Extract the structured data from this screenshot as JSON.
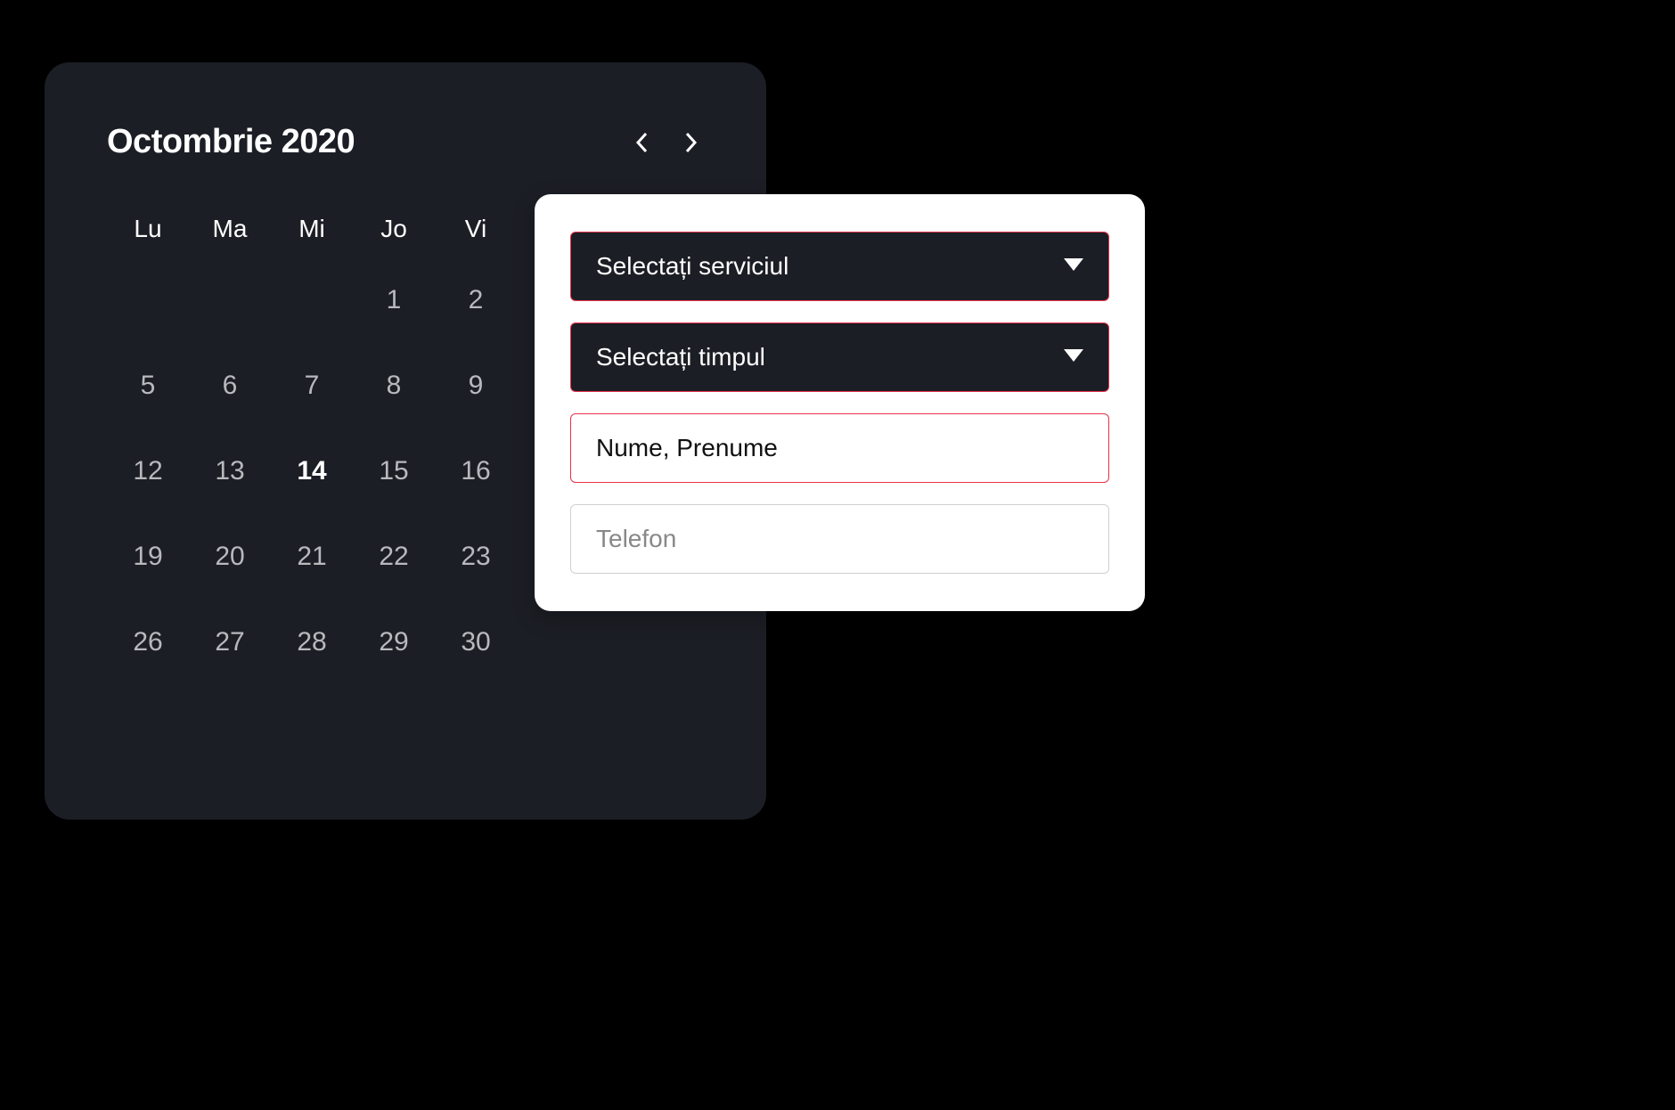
{
  "calendar": {
    "month_title": "Octombrie 2020",
    "weekdays": [
      "Lu",
      "Ma",
      "Mi",
      "Jo",
      "Vi"
    ],
    "days": [
      [
        "",
        "",
        "",
        "1",
        "2"
      ],
      [
        "5",
        "6",
        "7",
        "8",
        "9"
      ],
      [
        "12",
        "13",
        "14",
        "15",
        "16"
      ],
      [
        "19",
        "20",
        "21",
        "22",
        "23"
      ],
      [
        "26",
        "27",
        "28",
        "29",
        "30"
      ]
    ],
    "selected_day": "14"
  },
  "form": {
    "service_select": "Selectați serviciul",
    "time_select": "Selectați timpul",
    "name_placeholder": "Nume, Prenume",
    "phone_placeholder": "Telefon"
  },
  "colors": {
    "card_bg": "#1c1e25",
    "accent_green": "#4a9d4f",
    "accent_red": "#e9304b"
  }
}
